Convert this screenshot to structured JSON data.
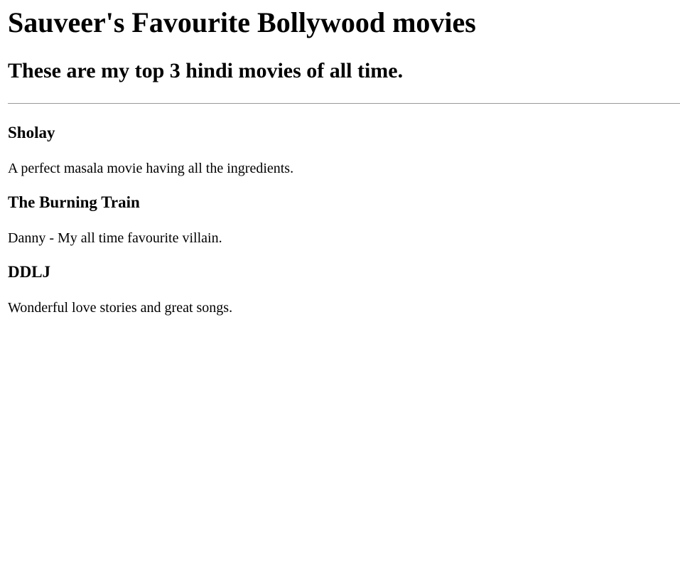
{
  "page": {
    "title": "Sauveer's Favourite Bollywood movies",
    "subtitle": "These are my top 3 hindi movies of all time."
  },
  "movies": [
    {
      "title": "Sholay",
      "description": "A perfect masala movie having all the ingredients."
    },
    {
      "title": "The Burning Train",
      "description": "Danny - My all time favourite villain."
    },
    {
      "title": "DDLJ",
      "description": "Wonderful love stories and great songs."
    }
  ]
}
